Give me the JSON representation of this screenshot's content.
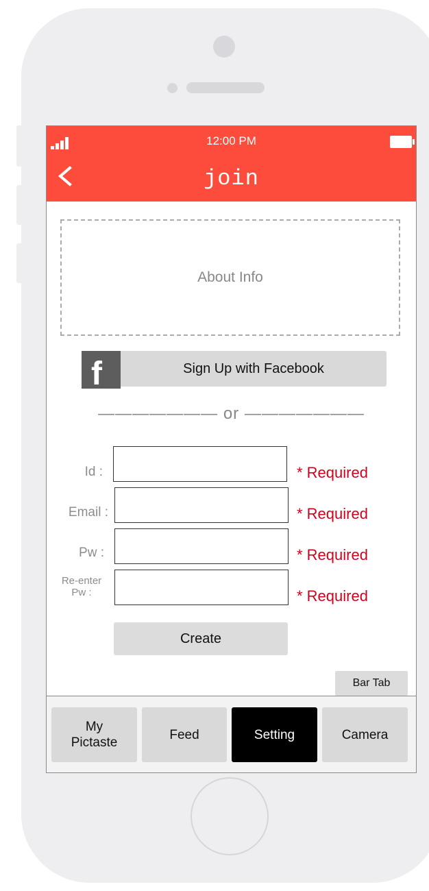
{
  "status_bar": {
    "time": "12:00 PM"
  },
  "nav": {
    "title": "join"
  },
  "about": {
    "text": "About Info"
  },
  "facebook": {
    "label": "Sign Up with Facebook",
    "logo_letter": "f"
  },
  "divider": {
    "text": "——————— or ———————"
  },
  "form": {
    "id_label": "Id :",
    "email_label": "Email :",
    "pw_label": "Pw :",
    "reenter_label_line1": "Re-enter",
    "reenter_label_line2": "Pw :",
    "required_text": "* Required"
  },
  "create_button": {
    "label": "Create"
  },
  "bar_tab_label": "Bar Tab",
  "tabs": [
    {
      "label_line1": "My",
      "label_line2": "Pictaste",
      "active": false
    },
    {
      "label": "Feed",
      "active": false
    },
    {
      "label": "Setting",
      "active": true
    },
    {
      "label": "Camera",
      "active": false
    }
  ],
  "colors": {
    "header": "#fe4c3c",
    "required": "#d0021b",
    "active_tab": "#000000"
  }
}
